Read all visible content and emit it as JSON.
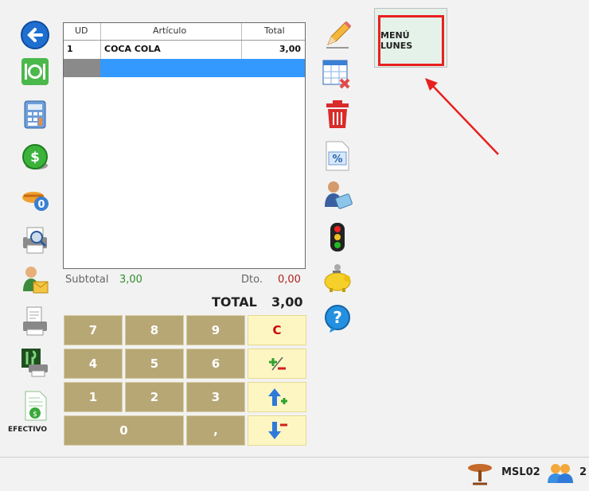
{
  "ticket": {
    "columns": [
      "UD",
      "Artículo",
      "Total"
    ],
    "rows": [
      {
        "ud": "1",
        "articulo": "COCA COLA",
        "total": "3,00"
      }
    ],
    "subtotal_label": "Subtotal",
    "subtotal_value": "3,00",
    "dto_label": "Dto.",
    "dto_value": "0,00",
    "total_label": "TOTAL",
    "total_value": "3,00"
  },
  "keypad": {
    "keys": [
      "7",
      "8",
      "9",
      "C",
      "4",
      "5",
      "6",
      "1",
      "2",
      "3",
      "0",
      ","
    ]
  },
  "menu_button": {
    "label": "MENÚ LUNES"
  },
  "left_toolbar": {
    "efectivo_label": "EFECTIVO"
  },
  "status": {
    "table_code": "MSL02",
    "guests": "2"
  },
  "colors": {
    "selected_row": "#3399ff",
    "keypad": "#b7a775",
    "highlight": "#e8201f",
    "menu_bg": "#e5f2ea"
  },
  "icons": [
    "back-arrow-icon",
    "table-setting-icon",
    "calculator-icon",
    "dollar-coin-icon",
    "dish-zero-icon",
    "print-preview-icon",
    "waiter-mail-icon",
    "printer-doc-icon",
    "kitchen-print-icon",
    "cash-document-icon",
    "pencil-icon",
    "table-delete-icon",
    "trash-icon",
    "percent-doc-icon",
    "user-card-icon",
    "traffic-light-icon",
    "piggy-bank-icon",
    "help-icon",
    "table-icon",
    "people-icon",
    "plus-minus-icon",
    "arrow-up-plus-icon",
    "arrow-down-minus-icon"
  ]
}
